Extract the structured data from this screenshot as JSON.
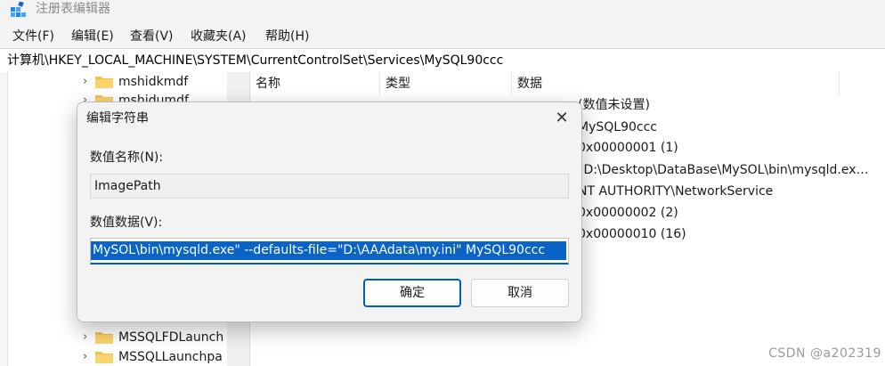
{
  "window": {
    "title": "注册表编辑器",
    "icon": "registry-editor-icon"
  },
  "menu": [
    "文件(F)",
    "编辑(E)",
    "查看(V)",
    "收藏夹(A)",
    "帮助(H)"
  ],
  "address": "计算机\\HKEY_LOCAL_MACHINE\\SYSTEM\\CurrentControlSet\\Services\\MySQL90ccc",
  "tree": {
    "items": [
      {
        "label": "mshidkmdf"
      },
      {
        "label": "mshidumdf"
      },
      {
        "label": "MSSQLFDLaunch"
      },
      {
        "label": "MSSQLLaunchpa"
      }
    ]
  },
  "list": {
    "columns": [
      "名称",
      "类型",
      "数据"
    ],
    "data_values": [
      "(数值未设置)",
      "MySQL90ccc",
      "0x00000001 (1)",
      "\"D:\\Desktop\\DataBase\\MySOL\\bin\\mysqld.ex…",
      "NT AUTHORITY\\NetworkService",
      "0x00000002 (2)",
      "0x00000010 (16)"
    ]
  },
  "dialog": {
    "title": "编辑字符串",
    "name_label": "数值名称(N):",
    "name_value": "ImagePath",
    "data_label": "数值数据(V):",
    "data_value": "MySOL\\bin\\mysqld.exe\" --defaults-file=\"D:\\AAAdata\\my.ini\" MySQL90ccc",
    "ok": "确定",
    "cancel": "取消",
    "close_icon": "close-icon"
  },
  "watermark": "CSDN @a202319",
  "colors": {
    "accent": "#005fb8",
    "selection": "#0a64c8",
    "folder": "#f5c04a"
  }
}
